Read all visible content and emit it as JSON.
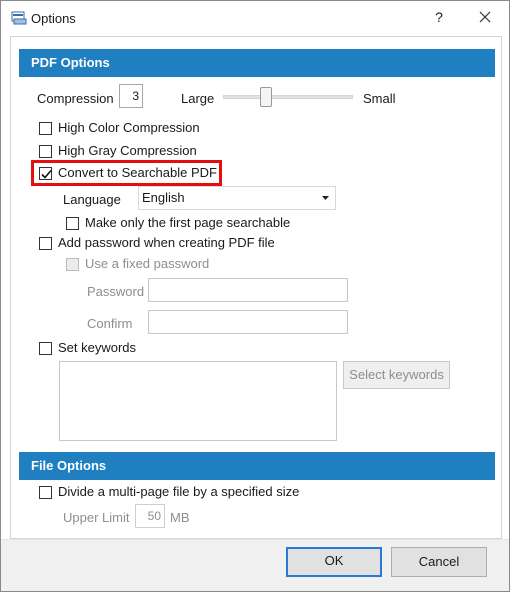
{
  "window": {
    "title": "Options",
    "help_glyph": "?"
  },
  "pdf_options": {
    "header": "PDF Options",
    "compression_label": "Compression",
    "compression_value": "3",
    "slider_left_label": "Large",
    "slider_right_label": "Small",
    "high_color": "High Color Compression",
    "high_gray": "High Gray Compression",
    "convert_searchable": "Convert to Searchable PDF",
    "convert_searchable_checked": true,
    "language_label": "Language",
    "language_value": "English",
    "first_page_only": "Make only the first page searchable",
    "add_password": "Add password when creating PDF file",
    "fixed_password": "Use a fixed password",
    "password_label": "Password",
    "confirm_label": "Confirm",
    "set_keywords": "Set keywords",
    "select_keywords_button": "Select keywords"
  },
  "file_options": {
    "header": "File Options",
    "divide_label": "Divide a multi-page file by a specified size",
    "upper_limit_label": "Upper Limit",
    "upper_limit_value": "50",
    "unit": "MB"
  },
  "footer": {
    "ok": "OK",
    "cancel": "Cancel"
  },
  "colors": {
    "section_header": "#1f7fc1",
    "highlight": "#e01010",
    "default_button_border": "#2a7ad5"
  },
  "icons": [
    "app-icon",
    "close-icon",
    "check-icon",
    "dropdown-caret-icon"
  ]
}
